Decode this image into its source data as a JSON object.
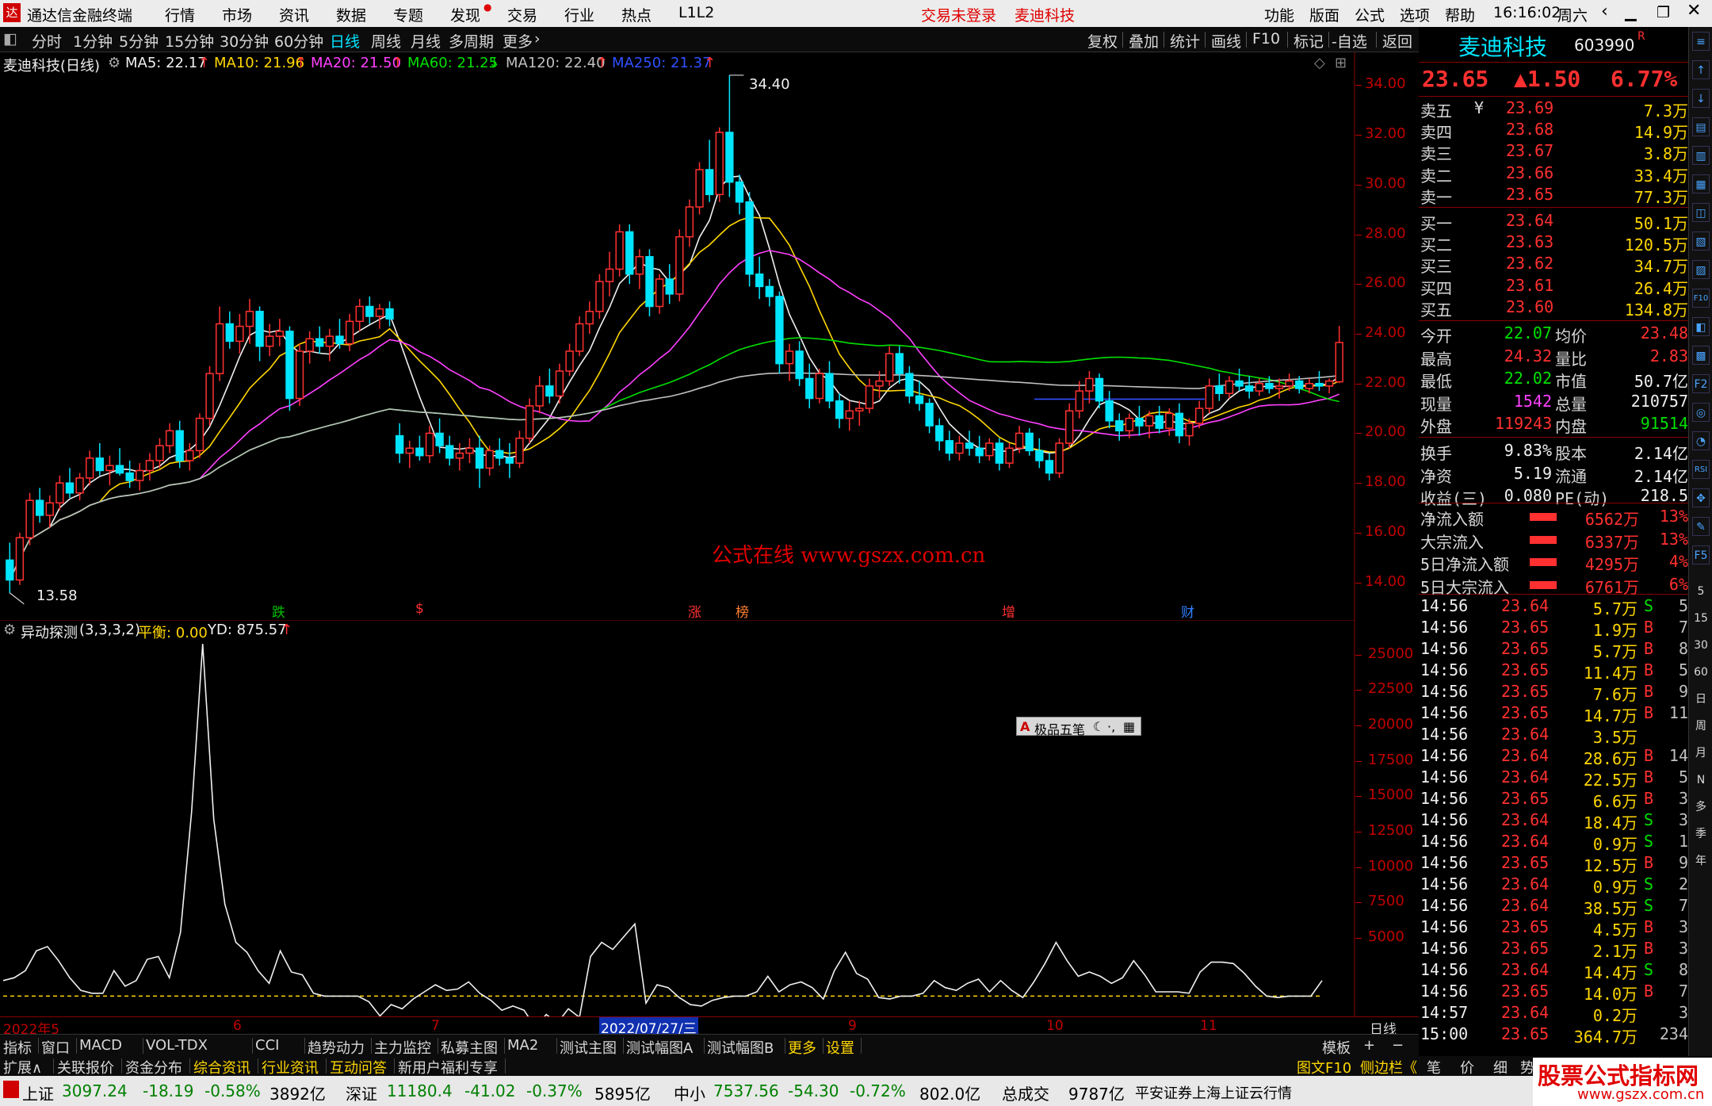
{
  "titlebar": {
    "app_name": "通达信金融终端",
    "menus": [
      "行情",
      "市场",
      "资讯",
      "数据",
      "专题",
      "发现",
      "交易",
      "行业",
      "热点",
      "L1L2"
    ],
    "login_status": "交易未登录",
    "stock_name": "麦迪科技",
    "right_menus": [
      "功能",
      "版面",
      "公式",
      "选项",
      "帮助"
    ],
    "time": "16:16:02",
    "weekday": "周六"
  },
  "timeframes": [
    "分时",
    "1分钟",
    "5分钟",
    "15分钟",
    "30分钟",
    "60分钟",
    "日线",
    "周线",
    "月线",
    "多周期",
    "更多"
  ],
  "active_timeframe": "日线",
  "chart_tools": [
    "复权",
    "叠加",
    "统计",
    "画线",
    "F10",
    "标记",
    "-自选",
    "返回"
  ],
  "ma_legend": {
    "title": "麦迪科技(日线)",
    "items": [
      {
        "label": "MA5: 22.17",
        "color": "#f0f0f0"
      },
      {
        "label": "MA10: 21.96",
        "color": "#ffd700"
      },
      {
        "label": "MA20: 21.50",
        "color": "#ff40ff"
      },
      {
        "label": "MA60: 21.25",
        "color": "#00e000"
      },
      {
        "label": "MA120: 22.40",
        "color": "#c0c0c0"
      },
      {
        "label": "MA250: 21.37",
        "color": "#3050ff"
      }
    ]
  },
  "price_axis": [
    "34.00",
    "32.00",
    "30.00",
    "28.00",
    "26.00",
    "24.00",
    "22.00",
    "20.00",
    "18.00",
    "16.00",
    "14.00"
  ],
  "high_label": "34.40",
  "low_label": "13.58",
  "watermark": "公式在线  www.gszx.com.cn",
  "event_tags": [
    {
      "t": "跌",
      "c": "#00c000"
    },
    {
      "t": "$",
      "c": "#ff3030"
    },
    {
      "t": "涨",
      "c": "#ff3030"
    },
    {
      "t": "榜",
      "c": "#ff8030"
    },
    {
      "t": "增",
      "c": "#ff3030"
    },
    {
      "t": "财",
      "c": "#3080ff"
    }
  ],
  "indicator": {
    "name": "异动探测",
    "params": "(3,3,3,2)",
    "balance": "平衡: 0.00",
    "yd": "YD: 875.57",
    "axis": [
      "25000",
      "22500",
      "20000",
      "17500",
      "15000",
      "12500",
      "10000",
      "7500",
      "5000"
    ]
  },
  "toolbox_label": "极品五笔",
  "date_axis": [
    "2022年5",
    "6",
    "7",
    "2022/07/27/三",
    "9",
    "10",
    "11"
  ],
  "date_axis_right": "日线",
  "stock": {
    "name": "麦迪科技",
    "code": "603990",
    "badge": "R",
    "price": "23.65",
    "change": "▲1.50",
    "pct": "6.77%"
  },
  "asks": [
    {
      "l": "卖五",
      "p": "23.69",
      "v": "7.3万"
    },
    {
      "l": "卖四",
      "p": "23.68",
      "v": "14.9万"
    },
    {
      "l": "卖三",
      "p": "23.67",
      "v": "3.8万"
    },
    {
      "l": "卖二",
      "p": "23.66",
      "v": "33.4万"
    },
    {
      "l": "卖一",
      "p": "23.65",
      "v": "77.3万"
    }
  ],
  "bids": [
    {
      "l": "买一",
      "p": "23.64",
      "v": "50.1万"
    },
    {
      "l": "买二",
      "p": "23.63",
      "v": "120.5万"
    },
    {
      "l": "买三",
      "p": "23.62",
      "v": "34.7万"
    },
    {
      "l": "买四",
      "p": "23.61",
      "v": "26.4万"
    },
    {
      "l": "买五",
      "p": "23.60",
      "v": "134.8万"
    }
  ],
  "stats": [
    {
      "a": "今开",
      "av": "22.07",
      "ac": "#00e000",
      "b": "均价",
      "bv": "23.48",
      "bc": "#ff3030"
    },
    {
      "a": "最高",
      "av": "24.32",
      "ac": "#ff3030",
      "b": "量比",
      "bv": "2.83",
      "bc": "#ff3030"
    },
    {
      "a": "最低",
      "av": "22.02",
      "ac": "#00e000",
      "b": "市值",
      "bv": "50.7亿",
      "bc": "#f0f0f0"
    },
    {
      "a": "现量",
      "av": "1542",
      "ac": "#ff40ff",
      "b": "总量",
      "bv": "210757",
      "bc": "#f0f0f0"
    },
    {
      "a": "外盘",
      "av": "119243",
      "ac": "#ff3030",
      "b": "内盘",
      "bv": "91514",
      "bc": "#00e000"
    }
  ],
  "stats2": [
    {
      "a": "换手",
      "av": "9.83%",
      "b": "股本",
      "bv": "2.14亿"
    },
    {
      "a": "净资",
      "av": "5.19",
      "b": "流通",
      "bv": "2.14亿"
    },
    {
      "a": "收益(三)",
      "av": "0.080",
      "b": "PE(动)",
      "bv": "218.5"
    }
  ],
  "flows": [
    {
      "l": "净流入额",
      "v": "6562万",
      "p": "13%"
    },
    {
      "l": "大宗流入",
      "v": "6337万",
      "p": "13%"
    },
    {
      "l": "5日净流入额",
      "v": "4295万",
      "p": "4%"
    },
    {
      "l": "5日大宗流入",
      "v": "6761万",
      "p": "6%"
    }
  ],
  "ticks": [
    [
      "14:56",
      "23.64",
      "5.7万",
      "S",
      "5"
    ],
    [
      "14:56",
      "23.65",
      "1.9万",
      "B",
      "7"
    ],
    [
      "14:56",
      "23.65",
      "5.7万",
      "B",
      "8"
    ],
    [
      "14:56",
      "23.65",
      "11.4万",
      "B",
      "5"
    ],
    [
      "14:56",
      "23.65",
      "7.6万",
      "B",
      "9"
    ],
    [
      "14:56",
      "23.65",
      "14.7万",
      "B",
      "11"
    ],
    [
      "14:56",
      "23.64",
      "3.5万",
      "",
      ""
    ],
    [
      "14:56",
      "23.64",
      "28.6万",
      "B",
      "14"
    ],
    [
      "14:56",
      "23.64",
      "22.5万",
      "B",
      "5"
    ],
    [
      "14:56",
      "23.65",
      "6.6万",
      "B",
      "3"
    ],
    [
      "14:56",
      "23.64",
      "18.4万",
      "S",
      "3"
    ],
    [
      "14:56",
      "23.64",
      "0.9万",
      "S",
      "1"
    ],
    [
      "14:56",
      "23.65",
      "12.5万",
      "B",
      "9"
    ],
    [
      "14:56",
      "23.64",
      "0.9万",
      "S",
      "2"
    ],
    [
      "14:56",
      "23.64",
      "38.5万",
      "S",
      "7"
    ],
    [
      "14:56",
      "23.65",
      "4.5万",
      "B",
      "3"
    ],
    [
      "14:56",
      "23.65",
      "2.1万",
      "B",
      "3"
    ],
    [
      "14:56",
      "23.64",
      "14.4万",
      "S",
      "8"
    ],
    [
      "14:56",
      "23.65",
      "14.0万",
      "B",
      "7"
    ],
    [
      "14:57",
      "23.64",
      "0.2万",
      "",
      "3"
    ],
    [
      "15:00",
      "23.65",
      "364.7万",
      "",
      "234"
    ]
  ],
  "bottom_tabs": [
    "指标",
    "窗口",
    "MACD",
    "VOL-TDX",
    "CCI",
    "趋势动力",
    "主力监控",
    "私募主图",
    "MA2",
    "测试主图",
    "测试幅图A",
    "测试幅图B",
    "更多",
    "设置"
  ],
  "bottom_right": "模板",
  "bottom_tabs2": [
    "扩展∧",
    "关联报价",
    "资金分布",
    "综合资讯",
    "行业资讯",
    "互动问答",
    "新用户福利专享"
  ],
  "bottom_right2": [
    "图文F10",
    "侧边栏《",
    "笔",
    "价",
    "细",
    "势"
  ],
  "indices": [
    {
      "n": "上证",
      "v": "3097.24",
      "c": "-18.19",
      "p": "-0.58%",
      "a": "3892亿"
    },
    {
      "n": "深证",
      "v": "11180.4",
      "c": "-41.02",
      "p": "-0.37%",
      "a": "5895亿"
    },
    {
      "n": "中小",
      "v": "7537.56",
      "c": "-54.30",
      "p": "-0.72%",
      "a": "802.0亿"
    }
  ],
  "total_label": "总成交",
  "total_value": "9787亿",
  "broker": "平安证券上海上证云行情",
  "logo_text": "股票公式指标网",
  "logo_url": "www.gszx.com.cn",
  "right_tools": [
    "≡",
    "↑",
    "↓",
    "▤",
    "▥",
    "▦",
    "◫",
    "▧",
    "▨",
    "F10",
    "◧",
    "▩",
    "F2",
    "◎",
    "◔",
    "RSI",
    "✥",
    "✎",
    "F5",
    "5",
    "15",
    "30",
    "60",
    "日",
    "周",
    "月",
    "N",
    "多",
    "季",
    "年"
  ],
  "chart_data": {
    "type": "candlestick",
    "price_range": [
      13,
      35
    ],
    "candles": [
      [
        14.9,
        15.6,
        13.58,
        14.1
      ],
      [
        14.1,
        16.0,
        13.9,
        15.8
      ],
      [
        15.8,
        17.6,
        15.5,
        17.3
      ],
      [
        17.3,
        17.8,
        16.4,
        16.7
      ],
      [
        16.7,
        17.5,
        16.2,
        17.2
      ],
      [
        17.2,
        18.3,
        16.9,
        18.0
      ],
      [
        18.0,
        18.6,
        17.4,
        17.6
      ],
      [
        17.6,
        18.4,
        17.3,
        18.2
      ],
      [
        18.2,
        19.3,
        17.9,
        19.0
      ],
      [
        19.0,
        19.6,
        18.3,
        18.5
      ],
      [
        18.5,
        19.1,
        17.9,
        18.7
      ],
      [
        18.7,
        19.4,
        18.3,
        18.4
      ],
      [
        18.4,
        18.9,
        17.8,
        18.1
      ],
      [
        18.1,
        18.8,
        17.7,
        18.5
      ],
      [
        18.5,
        19.2,
        18.1,
        18.9
      ],
      [
        18.9,
        19.8,
        18.6,
        19.5
      ],
      [
        19.5,
        20.4,
        19.2,
        20.1
      ],
      [
        20.1,
        20.5,
        18.6,
        18.9
      ],
      [
        18.9,
        19.6,
        18.5,
        19.3
      ],
      [
        19.3,
        20.8,
        19.0,
        20.6
      ],
      [
        20.6,
        22.7,
        20.3,
        22.4
      ],
      [
        22.4,
        25.1,
        22.1,
        24.4
      ],
      [
        24.4,
        24.9,
        23.4,
        23.7
      ],
      [
        23.7,
        24.8,
        23.2,
        24.3
      ],
      [
        24.3,
        25.4,
        23.6,
        24.9
      ],
      [
        24.9,
        25.1,
        22.9,
        23.5
      ],
      [
        23.5,
        24.4,
        23.1,
        23.9
      ],
      [
        23.9,
        24.6,
        23.5,
        24.1
      ],
      [
        24.1,
        24.3,
        20.9,
        21.4
      ],
      [
        21.4,
        23.6,
        21.1,
        23.3
      ],
      [
        23.3,
        24.1,
        22.8,
        23.8
      ],
      [
        23.8,
        24.3,
        23.2,
        23.5
      ],
      [
        23.5,
        24.2,
        22.9,
        23.9
      ],
      [
        23.9,
        24.6,
        23.4,
        23.6
      ],
      [
        23.6,
        24.8,
        23.3,
        24.5
      ],
      [
        24.5,
        25.4,
        24.1,
        25.1
      ],
      [
        25.1,
        25.5,
        24.4,
        24.7
      ],
      [
        24.7,
        25.2,
        24.2,
        25.0
      ],
      [
        25.0,
        25.3,
        24.3,
        24.6
      ],
      [
        19.9,
        20.4,
        18.8,
        19.2
      ],
      [
        19.2,
        19.7,
        18.6,
        19.4
      ],
      [
        19.4,
        19.9,
        18.9,
        19.1
      ],
      [
        19.1,
        20.3,
        18.8,
        20.0
      ],
      [
        20.0,
        20.6,
        19.2,
        19.5
      ],
      [
        19.5,
        19.9,
        18.7,
        19.0
      ],
      [
        19.0,
        19.6,
        18.5,
        19.2
      ],
      [
        19.2,
        19.8,
        18.8,
        19.4
      ],
      [
        19.4,
        19.9,
        17.8,
        18.6
      ],
      [
        18.6,
        19.5,
        18.3,
        19.3
      ],
      [
        19.3,
        19.8,
        18.7,
        19.0
      ],
      [
        19.0,
        19.6,
        18.2,
        18.8
      ],
      [
        18.8,
        20.1,
        18.6,
        19.8
      ],
      [
        19.8,
        21.4,
        19.6,
        21.1
      ],
      [
        21.1,
        22.3,
        20.8,
        21.9
      ],
      [
        21.9,
        22.6,
        21.2,
        21.5
      ],
      [
        21.5,
        22.8,
        21.2,
        22.5
      ],
      [
        22.5,
        23.6,
        22.3,
        23.3
      ],
      [
        23.3,
        24.7,
        23.1,
        24.4
      ],
      [
        24.4,
        25.3,
        24.0,
        24.9
      ],
      [
        24.9,
        26.4,
        24.6,
        26.1
      ],
      [
        26.1,
        27.3,
        25.5,
        26.6
      ],
      [
        26.6,
        28.4,
        26.3,
        28.1
      ],
      [
        28.1,
        28.4,
        26.0,
        26.4
      ],
      [
        26.4,
        27.4,
        25.8,
        27.1
      ],
      [
        27.1,
        27.4,
        24.7,
        25.1
      ],
      [
        25.1,
        26.4,
        24.8,
        26.2
      ],
      [
        26.2,
        26.8,
        25.2,
        25.6
      ],
      [
        25.6,
        28.2,
        25.3,
        27.9
      ],
      [
        27.9,
        29.4,
        27.5,
        29.1
      ],
      [
        29.1,
        30.9,
        28.8,
        30.6
      ],
      [
        30.6,
        31.8,
        29.3,
        29.6
      ],
      [
        29.6,
        32.3,
        29.3,
        32.1
      ],
      [
        32.1,
        34.4,
        29.5,
        30.1
      ],
      [
        30.1,
        30.4,
        28.8,
        29.3
      ],
      [
        29.3,
        29.7,
        25.9,
        26.4
      ],
      [
        26.4,
        27.1,
        25.4,
        25.9
      ],
      [
        25.9,
        26.2,
        25.1,
        25.5
      ],
      [
        25.5,
        25.7,
        22.4,
        22.8
      ],
      [
        22.8,
        23.6,
        22.1,
        23.3
      ],
      [
        23.3,
        23.7,
        21.9,
        22.2
      ],
      [
        22.2,
        22.8,
        21.0,
        21.4
      ],
      [
        21.4,
        22.6,
        21.2,
        22.4
      ],
      [
        22.4,
        22.9,
        21.0,
        21.3
      ],
      [
        21.3,
        21.6,
        20.2,
        20.6
      ],
      [
        20.6,
        21.3,
        20.1,
        20.9
      ],
      [
        20.9,
        21.3,
        20.3,
        21.0
      ],
      [
        21.0,
        22.2,
        20.8,
        21.9
      ],
      [
        21.9,
        22.5,
        21.4,
        22.1
      ],
      [
        22.1,
        23.5,
        21.9,
        23.2
      ],
      [
        23.2,
        23.5,
        22.0,
        22.4
      ],
      [
        22.4,
        22.7,
        21.2,
        21.5
      ],
      [
        21.5,
        22.1,
        20.9,
        21.2
      ],
      [
        21.2,
        21.4,
        20.0,
        20.3
      ],
      [
        20.3,
        20.6,
        19.3,
        19.7
      ],
      [
        19.7,
        20.1,
        18.9,
        19.2
      ],
      [
        19.2,
        19.9,
        18.9,
        19.6
      ],
      [
        19.6,
        20.1,
        19.1,
        19.4
      ],
      [
        19.4,
        19.9,
        18.8,
        19.1
      ],
      [
        19.1,
        19.8,
        18.9,
        19.6
      ],
      [
        19.6,
        19.8,
        18.5,
        18.8
      ],
      [
        18.8,
        19.6,
        18.6,
        19.4
      ],
      [
        19.4,
        20.3,
        19.2,
        20.0
      ],
      [
        20.0,
        20.2,
        19.1,
        19.3
      ],
      [
        19.3,
        19.8,
        18.6,
        18.9
      ],
      [
        18.9,
        19.2,
        18.1,
        18.4
      ],
      [
        18.4,
        19.8,
        18.2,
        19.6
      ],
      [
        19.6,
        21.2,
        19.4,
        20.9
      ],
      [
        20.9,
        22.1,
        20.6,
        21.7
      ],
      [
        21.7,
        22.5,
        21.2,
        22.2
      ],
      [
        22.2,
        22.4,
        21.0,
        21.3
      ],
      [
        21.3,
        21.7,
        20.2,
        20.5
      ],
      [
        20.5,
        20.8,
        19.7,
        20.1
      ],
      [
        20.1,
        20.8,
        19.8,
        20.6
      ],
      [
        20.6,
        21.1,
        19.9,
        20.3
      ],
      [
        20.3,
        20.9,
        19.8,
        20.7
      ],
      [
        20.7,
        21.1,
        20.0,
        20.2
      ],
      [
        20.2,
        21.0,
        19.9,
        20.8
      ],
      [
        20.8,
        21.2,
        19.6,
        19.9
      ],
      [
        19.9,
        20.6,
        19.5,
        20.4
      ],
      [
        20.4,
        21.3,
        20.2,
        21.0
      ],
      [
        21.0,
        22.2,
        20.8,
        21.9
      ],
      [
        21.9,
        22.4,
        21.3,
        21.6
      ],
      [
        21.6,
        22.3,
        21.4,
        22.1
      ],
      [
        22.1,
        22.6,
        21.7,
        21.9
      ],
      [
        21.9,
        22.3,
        21.4,
        21.7
      ],
      [
        21.7,
        22.2,
        21.5,
        22.0
      ],
      [
        22.0,
        22.3,
        21.6,
        21.8
      ],
      [
        21.8,
        22.2,
        21.4,
        21.9
      ],
      [
        21.9,
        22.4,
        21.7,
        22.1
      ],
      [
        22.1,
        22.3,
        21.6,
        21.8
      ],
      [
        21.8,
        22.2,
        21.6,
        22.0
      ],
      [
        22.0,
        22.5,
        21.7,
        21.9
      ],
      [
        21.9,
        22.2,
        21.6,
        22.1
      ],
      [
        22.07,
        24.32,
        22.02,
        23.65
      ]
    ],
    "indicator_range": [
      0,
      26000
    ],
    "indicator_values": [
      1100,
      1300,
      1800,
      3200,
      3500,
      2500,
      1300,
      400,
      200,
      200,
      1800,
      700,
      1100,
      2600,
      2800,
      1300,
      4500,
      13000,
      24900,
      12500,
      6500,
      3800,
      3100,
      1800,
      900,
      3200,
      1700,
      1500,
      200,
      0,
      0,
      0,
      0,
      -400,
      -1400,
      -600,
      -900,
      -200,
      300,
      800,
      400,
      500,
      1000,
      200,
      -300,
      -1000,
      -700,
      -1000,
      -2200,
      -1300,
      -1900,
      -900,
      -1500,
      2800,
      3800,
      3300,
      4200,
      5100,
      -500,
      800,
      600,
      -100,
      -600,
      -700,
      -300,
      -100,
      0,
      0,
      300,
      1400,
      300,
      800,
      1000,
      600,
      -200,
      1800,
      3100,
      1600,
      1200,
      -100,
      -200,
      0,
      0,
      200,
      1100,
      600,
      400,
      900,
      1200,
      300,
      1100,
      400,
      -100,
      1000,
      2300,
      3800,
      2500,
      1400,
      1700,
      1400,
      900,
      1300,
      2500,
      1500,
      300,
      300,
      300,
      200,
      1700,
      2400,
      2400,
      2300,
      1600,
      700,
      0,
      -100,
      0,
      0,
      0,
      1100
    ]
  }
}
